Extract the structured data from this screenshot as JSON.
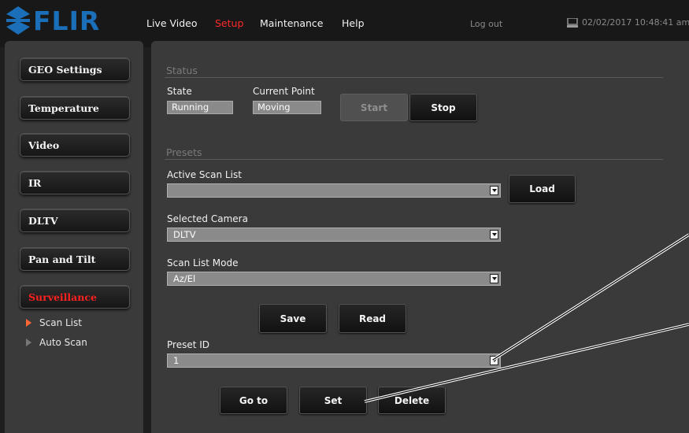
{
  "header": {
    "logo_text": "FLIR",
    "nav": [
      "Live Video",
      "Setup",
      "Maintenance",
      "Help"
    ],
    "active_nav": "Setup",
    "logout": "Log out",
    "datetime": "02/02/2017 10:48:41 am"
  },
  "sidebar": {
    "buttons": [
      "GEO Settings",
      "Temperature",
      "Video",
      "IR",
      "DLTV",
      "Pan and Tilt",
      "Surveillance"
    ],
    "active": "Surveillance",
    "subitems": [
      "Scan List",
      "Auto Scan"
    ],
    "active_subitem": "Scan List"
  },
  "status": {
    "title": "Status",
    "state_label": "State",
    "state_value": "Running",
    "point_label": "Current Point",
    "point_value": "Moving",
    "start_label": "Start",
    "stop_label": "Stop"
  },
  "presets": {
    "title": "Presets",
    "active_scan_list_label": "Active Scan List",
    "active_scan_list_value": "",
    "load_label": "Load",
    "selected_camera_label": "Selected Camera",
    "selected_camera_value": "DLTV",
    "scan_mode_label": "Scan List Mode",
    "scan_mode_value": "Az/El",
    "save_label": "Save",
    "read_label": "Read",
    "preset_id_label": "Preset ID",
    "preset_id_value": "1",
    "goto_label": "Go to",
    "set_label": "Set",
    "delete_label": "Delete"
  },
  "colors": {
    "accent_red": "#ff2020",
    "logo_blue": "#1a6fb8",
    "panel_bg": "#3a3a3a"
  }
}
